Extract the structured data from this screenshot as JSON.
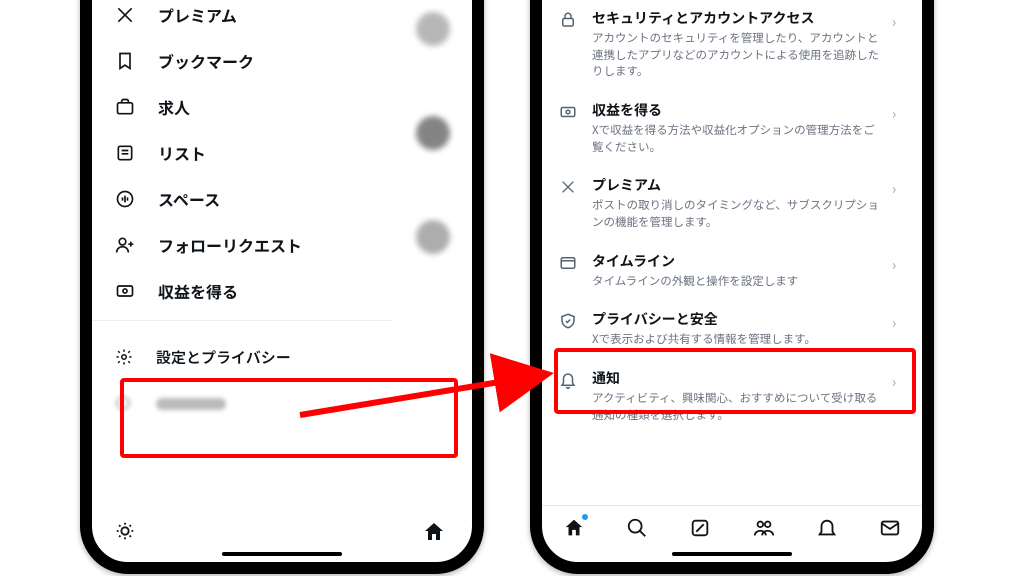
{
  "left_phone": {
    "menu": [
      {
        "id": "premium",
        "label": "プレミアム"
      },
      {
        "id": "bookmarks",
        "label": "ブックマーク"
      },
      {
        "id": "jobs",
        "label": "求人"
      },
      {
        "id": "lists",
        "label": "リスト"
      },
      {
        "id": "spaces",
        "label": "スペース"
      },
      {
        "id": "follow-requests",
        "label": "フォローリクエスト"
      },
      {
        "id": "monetization",
        "label": "収益を得る"
      }
    ],
    "settings_label": "設定とプライバシー"
  },
  "right_phone": {
    "items": [
      {
        "id": "security",
        "title": "セキュリティとアカウントアクセス",
        "desc": "アカウントのセキュリティを管理したり、アカウントと連携したアプリなどのアカウントによる使用を追跡したりします。"
      },
      {
        "id": "monetization",
        "title": "収益を得る",
        "desc": "Xで収益を得る方法や収益化オプションの管理方法をご覧ください。"
      },
      {
        "id": "premium",
        "title": "プレミアム",
        "desc": "ポストの取り消しのタイミングなど、サブスクリプションの機能を管理します。"
      },
      {
        "id": "timeline",
        "title": "タイムライン",
        "desc": "タイムラインの外観と操作を設定します"
      },
      {
        "id": "privacy",
        "title": "プライバシーと安全",
        "desc": "Xで表示および共有する情報を管理します。"
      },
      {
        "id": "notifications",
        "title": "通知",
        "desc": "アクティビティ、興味関心、おすすめについて受け取る通知の種類を選択します。"
      }
    ]
  },
  "highlight_color": "#ff0000"
}
